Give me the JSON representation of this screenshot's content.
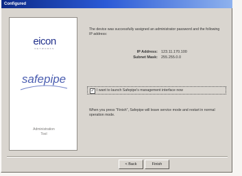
{
  "window": {
    "title": "Configured"
  },
  "branding": {
    "eicon": {
      "name": "eicon",
      "tagline": "NETWORKS"
    },
    "safepipe": {
      "name": "safepipe"
    },
    "caption_line1": "Administration",
    "caption_line2": "Tool"
  },
  "content": {
    "message": "The device was successfully assigned an administrator password and the following IP address:",
    "ip_address_label": "IP Address:",
    "ip_address_value": "123.11.170.100",
    "subnet_mask_label": "Subnet Mask:",
    "subnet_mask_value": "255.255.0.0",
    "checkbox_label": "I want to launch Safepipe's management interface now",
    "checkbox_checked": true,
    "checkbox_mark": "✓",
    "note": "When you press \"Finish\", Safepipe will leave service mode and restart in normal operation mode."
  },
  "buttons": {
    "back": "< Back",
    "finish": "Finish"
  },
  "colors": {
    "title_bar": "#0c2a86",
    "eicon_blue": "#22318c",
    "safepipe_blue": "#4a5db0"
  }
}
